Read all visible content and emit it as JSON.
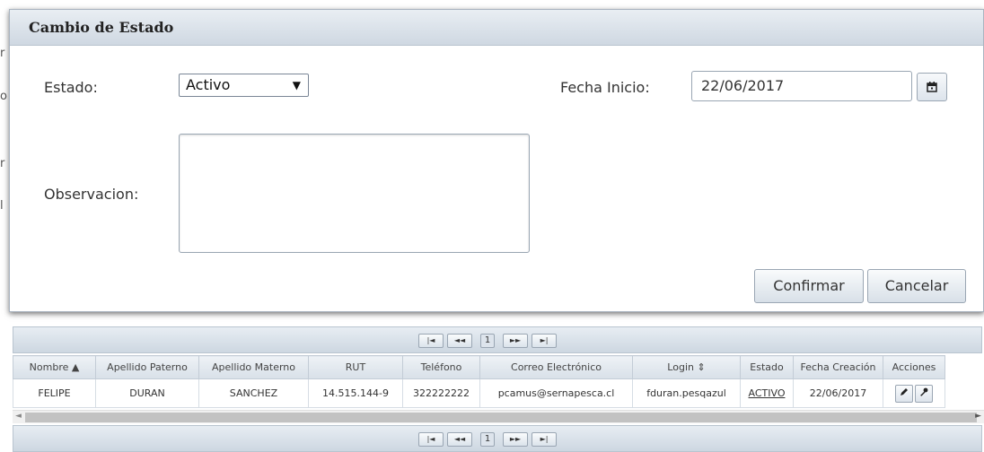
{
  "dialog": {
    "title": "Cambio de Estado",
    "estado_label": "Estado:",
    "estado_value": "Activo",
    "fecha_label": "Fecha Inicio:",
    "fecha_value": "22/06/2017",
    "observacion_label": "Observacion:",
    "observacion_value": "",
    "confirm_label": "Confirmar",
    "cancel_label": "Cancelar"
  },
  "pager": {
    "first": "|◄",
    "prev": "◄◄",
    "page": "1",
    "next": "►►",
    "last": "►|"
  },
  "table": {
    "columns": [
      "Nombre ▲",
      "Apellido Paterno",
      "Apellido Materno",
      "RUT",
      "Teléfono",
      "Correo Electrónico",
      "Login ⇕",
      "Estado",
      "Fecha Creación",
      "Acciones"
    ],
    "row": {
      "nombre": "FELIPE",
      "apellido_paterno": "DURAN",
      "apellido_materno": "SANCHEZ",
      "rut": "14.515.144-9",
      "telefono": "322222222",
      "correo": "pcamus@sernapesca.cl",
      "login": "fduran.pesqazul",
      "estado": "ACTIVO",
      "fecha_creacion": "22/06/2017"
    }
  },
  "icons": {
    "calendar": "calendar-icon",
    "edit": "pencil-icon",
    "key": "key-icon"
  }
}
